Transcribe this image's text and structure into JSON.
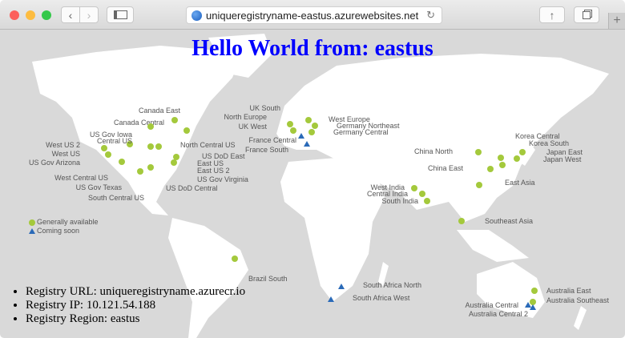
{
  "browser": {
    "url": "uniqueregistryname-eastus.azurewebsites.net",
    "back_icon": "chevron-left",
    "forward_icon": "chevron-right",
    "sidebar_icon": "sidebar",
    "share_icon": "share",
    "tabs_icon": "tabs",
    "new_tab": "+",
    "reload_icon": "↻"
  },
  "page": {
    "heading": "Hello World from: eastus",
    "details": [
      "Registry URL: uniqueregistryname.azurecr.io",
      "Registry IP: 10.121.54.188",
      "Registry Region: eastus"
    ]
  },
  "map": {
    "legend": {
      "available": "Generally available",
      "coming": "Coming soon"
    },
    "colors": {
      "available": "#a4c93c",
      "coming": "#2a6ab8"
    },
    "regions": [
      {
        "name": "Canada East",
        "status": "available"
      },
      {
        "name": "Canada Central",
        "status": "available"
      },
      {
        "name": "US Gov Iowa",
        "status": "available"
      },
      {
        "name": "Central US",
        "status": "available"
      },
      {
        "name": "West US 2",
        "status": "available"
      },
      {
        "name": "West US",
        "status": "available"
      },
      {
        "name": "US Gov Arizona",
        "status": "available"
      },
      {
        "name": "North Central US",
        "status": "available"
      },
      {
        "name": "US DoD East",
        "status": "available"
      },
      {
        "name": "East US",
        "status": "available"
      },
      {
        "name": "East US 2",
        "status": "available"
      },
      {
        "name": "US Gov Virginia",
        "status": "available"
      },
      {
        "name": "West Central US",
        "status": "available"
      },
      {
        "name": "US Gov Texas",
        "status": "available"
      },
      {
        "name": "US DoD Central",
        "status": "available"
      },
      {
        "name": "South Central US",
        "status": "available"
      },
      {
        "name": "UK South",
        "status": "available"
      },
      {
        "name": "North Europe",
        "status": "available"
      },
      {
        "name": "UK West",
        "status": "available"
      },
      {
        "name": "West Europe",
        "status": "available"
      },
      {
        "name": "Germany Northeast",
        "status": "available"
      },
      {
        "name": "Germany Central",
        "status": "available"
      },
      {
        "name": "France Central",
        "status": "coming"
      },
      {
        "name": "France South",
        "status": "coming"
      },
      {
        "name": "China North",
        "status": "available"
      },
      {
        "name": "China East",
        "status": "available"
      },
      {
        "name": "East Asia",
        "status": "available"
      },
      {
        "name": "Korea Central",
        "status": "available"
      },
      {
        "name": "Korea South",
        "status": "available"
      },
      {
        "name": "Japan East",
        "status": "available"
      },
      {
        "name": "Japan West",
        "status": "available"
      },
      {
        "name": "West India",
        "status": "available"
      },
      {
        "name": "Central India",
        "status": "available"
      },
      {
        "name": "South India",
        "status": "available"
      },
      {
        "name": "Southeast Asia",
        "status": "available"
      },
      {
        "name": "Brazil South",
        "status": "available"
      },
      {
        "name": "South Africa North",
        "status": "coming"
      },
      {
        "name": "South Africa West",
        "status": "coming"
      },
      {
        "name": "Australia East",
        "status": "available"
      },
      {
        "name": "Australia Southeast",
        "status": "available"
      },
      {
        "name": "Australia Central",
        "status": "coming"
      },
      {
        "name": "Australia Central 2",
        "status": "coming"
      }
    ]
  }
}
